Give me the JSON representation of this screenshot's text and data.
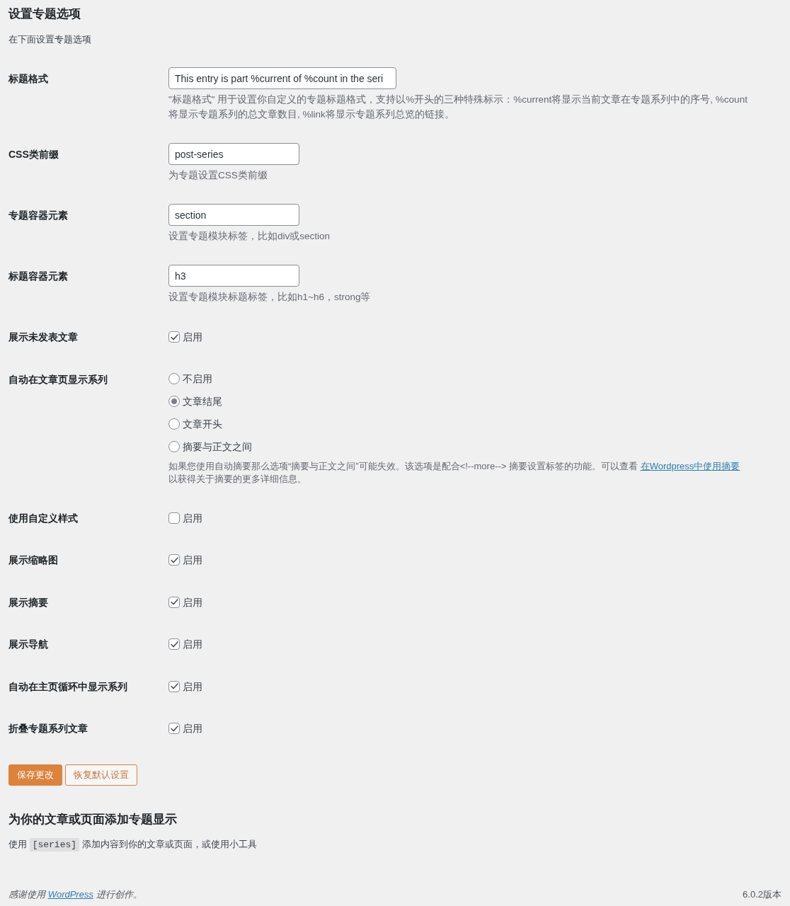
{
  "page": {
    "title": "设置专题选项",
    "subtitle": "在下面设置专题选项"
  },
  "settings": [
    {
      "kind": "long_text",
      "label": "标题格式",
      "value": "This entry is part %current of %count in the seri",
      "description": "\"标题格式\" 用于设置你自定义的专题标题格式，支持以%开头的三种特殊标示：%current将显示当前文章在专题系列中的序号, %count将显示专题系列的总文章数目, %link将显示专题系列总览的链接。"
    },
    {
      "kind": "text",
      "label": "CSS类前缀",
      "value": "post-series",
      "description": "为专题设置CSS类前缀"
    },
    {
      "kind": "text",
      "label": "专题容器元素",
      "value": "section",
      "description": "设置专题模块标签，比如div或section"
    },
    {
      "kind": "text",
      "label": "标题容器元素",
      "value": "h3",
      "description": "设置专题模块标题标签，比如h1~h6，strong等"
    },
    {
      "kind": "checkbox",
      "label": "展示未发表文章",
      "option": "启用",
      "checked": true
    },
    {
      "kind": "radio",
      "label": "自动在文章页显示系列",
      "options": [
        {
          "label": "不启用",
          "selected": false
        },
        {
          "label": "文章结尾",
          "selected": true
        },
        {
          "label": "文章开头",
          "selected": false
        },
        {
          "label": "摘要与正文之间",
          "selected": false
        }
      ],
      "note": {
        "before": "如果您使用自动摘要那么选项“摘要与正文之间”可能失效。该选项是配合<!--more--> 摘要设置标签的功能。可以查看 ",
        "link": "在Wordpress中使用摘要",
        "after": " 以获得关于摘要的更多详细信息。"
      }
    },
    {
      "kind": "checkbox",
      "label": "使用自定义样式",
      "option": "启用",
      "checked": false
    },
    {
      "kind": "checkbox",
      "label": "展示缩略图",
      "option": "启用",
      "checked": true
    },
    {
      "kind": "checkbox",
      "label": "展示摘要",
      "option": "启用",
      "checked": true
    },
    {
      "kind": "checkbox",
      "label": "展示导航",
      "option": "启用",
      "checked": true
    },
    {
      "kind": "checkbox",
      "label": "自动在主页循环中显示系列",
      "option": "启用",
      "checked": true
    },
    {
      "kind": "checkbox",
      "label": "折叠专题系列文章",
      "option": "启用",
      "checked": true
    }
  ],
  "buttons": [
    {
      "label": "保存更改",
      "kind": "primary"
    },
    {
      "label": "恢复默认设置",
      "kind": "secondary"
    }
  ],
  "shortcode_section": {
    "title": "为你的文章或页面添加专题显示",
    "before": "使用 ",
    "code": "[series]",
    "after": " 添加内容到你的文章或页面，或使用小工具"
  },
  "footer": {
    "before": "感谢使用 ",
    "link": "WordPress",
    "after": " 进行创作。",
    "version": "6.0.2版本"
  }
}
